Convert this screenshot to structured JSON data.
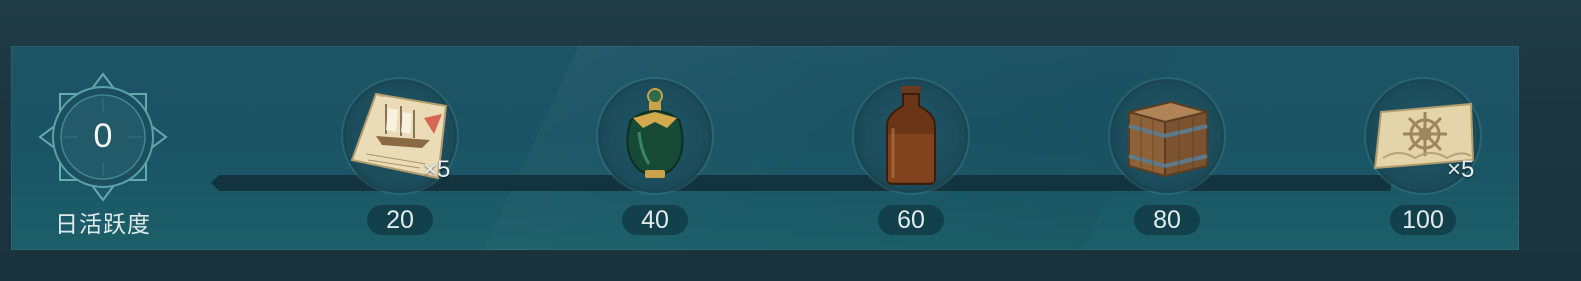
{
  "activity": {
    "value": "0",
    "label": "日活跃度"
  },
  "milestones": [
    {
      "threshold": "20",
      "item": "ship-map-scroll",
      "quantity": "×5"
    },
    {
      "threshold": "40",
      "item": "green-potion-bottle",
      "quantity": ""
    },
    {
      "threshold": "60",
      "item": "brown-bottle",
      "quantity": ""
    },
    {
      "threshold": "80",
      "item": "wooden-crate",
      "quantity": ""
    },
    {
      "threshold": "100",
      "item": "helm-ticket",
      "quantity": "×5"
    }
  ],
  "colors": {
    "panel": "#1d5466",
    "track": "#13343e",
    "text": "#e2ebec"
  }
}
